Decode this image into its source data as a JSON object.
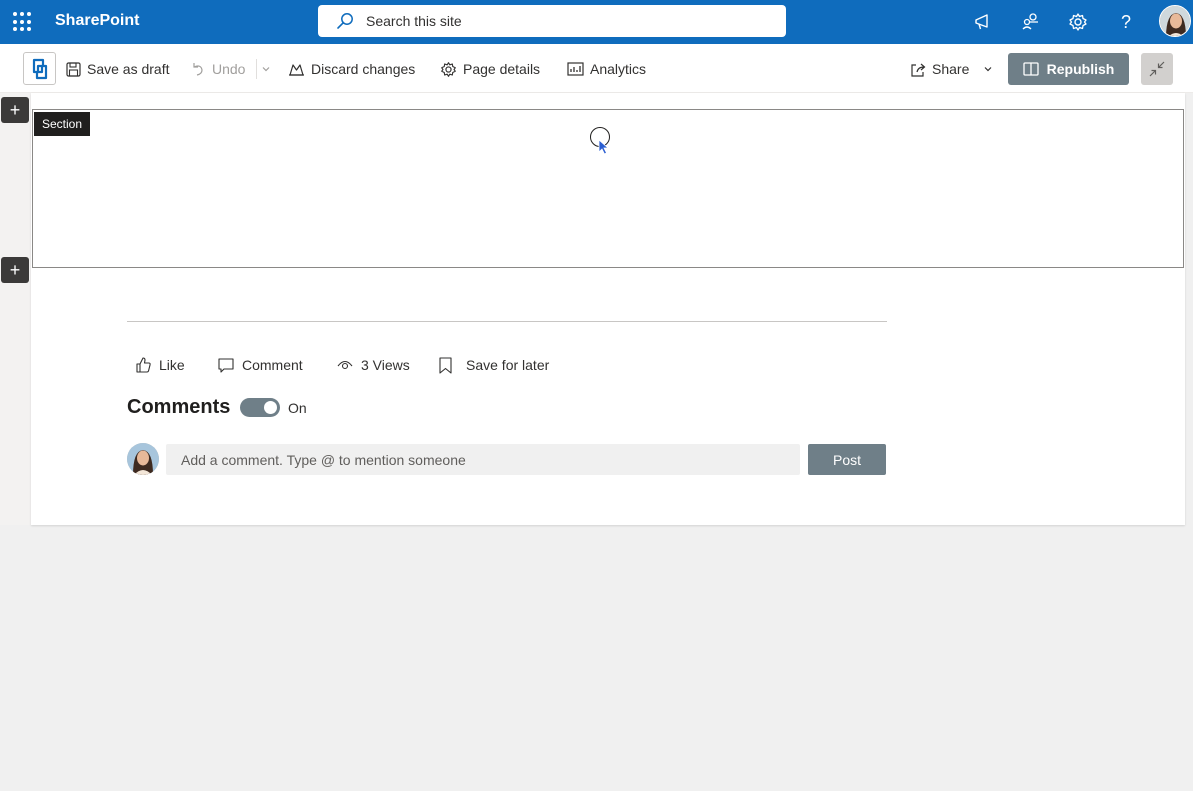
{
  "suitebar": {
    "app_name": "SharePoint",
    "search_placeholder": "Search this site",
    "icons": [
      "app-launcher-icon",
      "megaphone-icon",
      "share-people-icon",
      "settings-icon",
      "help-icon",
      "profile-avatar"
    ],
    "help_glyph": "?",
    "color": "#0f6cbd"
  },
  "command_bar": {
    "save_draft": "Save as draft",
    "undo": "Undo",
    "discard": "Discard changes",
    "page_details": "Page details",
    "analytics": "Analytics",
    "share": "Share",
    "republish": "Republish"
  },
  "canvas": {
    "section_label": "Section",
    "add_section_glyph": "+"
  },
  "social": {
    "like": "Like",
    "comment": "Comment",
    "views": "3 Views",
    "save_later": "Save for later"
  },
  "comments": {
    "title": "Comments",
    "toggle_state": "On",
    "toggle_on": true,
    "input_placeholder": "Add a comment. Type @ to mention someone",
    "post_label": "Post"
  }
}
